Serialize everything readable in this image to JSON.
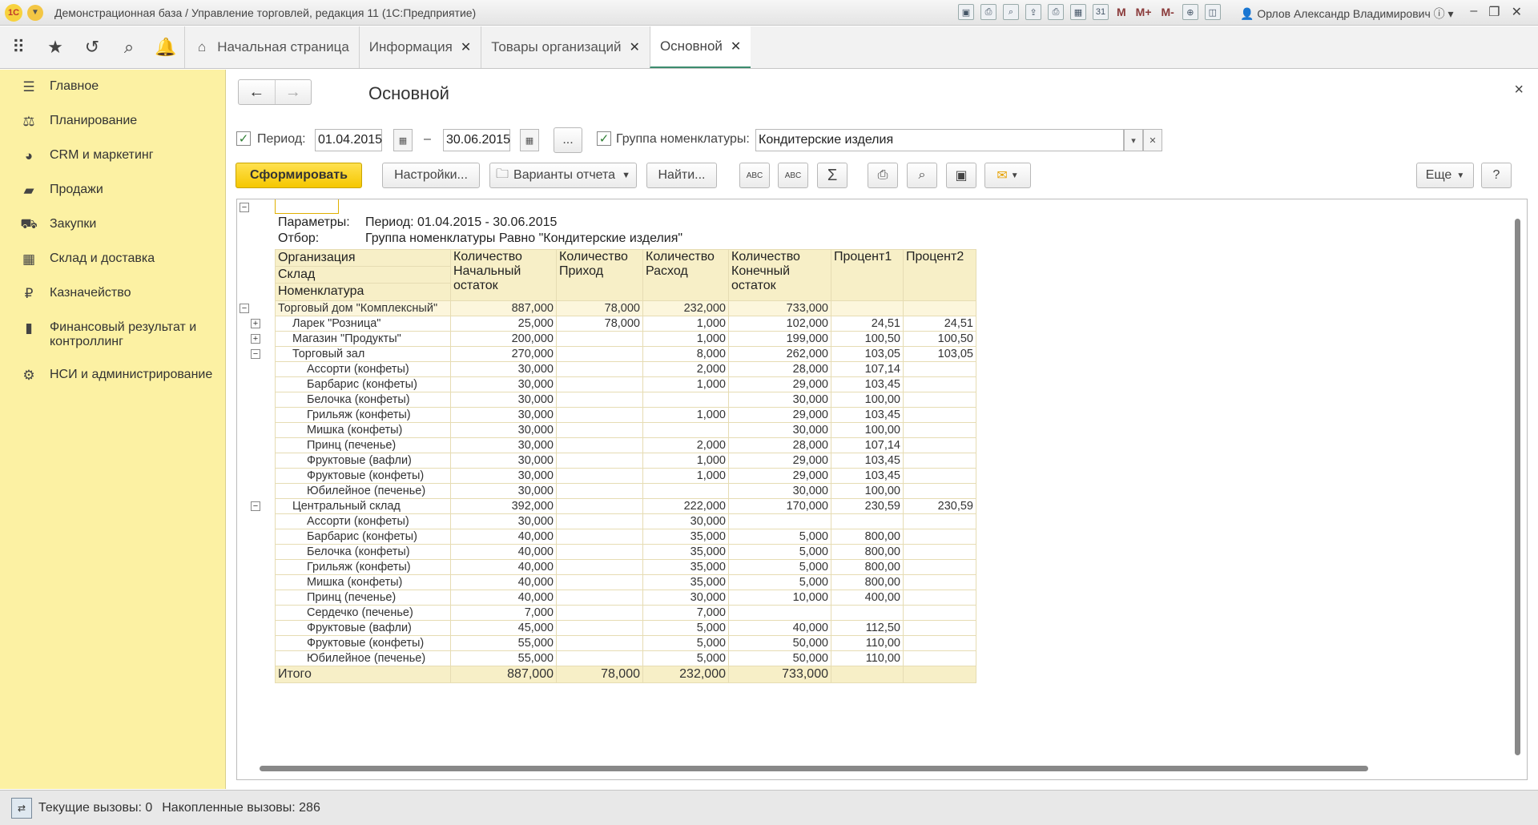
{
  "window": {
    "title": "Демонстрационная база / Управление торговлей, редакция 11  (1С:Предприятие)",
    "user": "Орлов Александр Владимирович",
    "logo": "1C",
    "m_buttons": [
      "M",
      "M+",
      "M-"
    ]
  },
  "tabs": [
    {
      "label": "Начальная страница"
    },
    {
      "label": "Информация"
    },
    {
      "label": "Товары организаций"
    },
    {
      "label": "Основной"
    }
  ],
  "sidebar": {
    "items": [
      {
        "label": "Главное",
        "icon": "menu-icon"
      },
      {
        "label": "Планирование",
        "icon": "planning-icon"
      },
      {
        "label": "CRM и маркетинг",
        "icon": "pie-icon"
      },
      {
        "label": "Продажи",
        "icon": "bag-icon"
      },
      {
        "label": "Закупки",
        "icon": "cart-icon"
      },
      {
        "label": "Склад и доставка",
        "icon": "warehouse-icon"
      },
      {
        "label": "Казначейство",
        "icon": "ruble-icon"
      },
      {
        "label": "Финансовый результат и контроллинг",
        "icon": "chart-icon"
      },
      {
        "label": "НСИ и администрирование",
        "icon": "gear-icon"
      }
    ]
  },
  "form": {
    "title": "Основной",
    "period_label": "Период:",
    "date_from": "01.04.2015",
    "dash": "–",
    "date_to": "30.06.2015",
    "ellipsis": "...",
    "group_label": "Группа номенклатуры:",
    "group_value": "Кондитерские изделия",
    "buttons": {
      "generate": "Сформировать",
      "settings": "Настройки...",
      "variants": "Варианты отчета",
      "find": "Найти...",
      "more": "Еще",
      "help": "?"
    }
  },
  "report": {
    "params_label": "Параметры:",
    "params_value": "Период: 01.04.2015 - 30.06.2015",
    "filter_label": "Отбор:",
    "filter_value": "Группа номенклатуры Равно \"Кондитерские изделия\"",
    "headers": {
      "org": "Организация",
      "wh": "Склад",
      "item": "Номенклатура",
      "c1": "Количество Начальный остаток",
      "c2": "Количество Приход",
      "c3": "Количество Расход",
      "c4": "Количество Конечный остаток",
      "c5": "Процент1",
      "c6": "Процент2"
    },
    "rows": [
      {
        "level": 0,
        "name": "Торговый дом \"Комплексный\"",
        "v": [
          "887,000",
          "78,000",
          "232,000",
          "733,000",
          "",
          ""
        ]
      },
      {
        "level": 1,
        "name": "Ларек \"Розница\"",
        "v": [
          "25,000",
          "78,000",
          "1,000",
          "102,000",
          "24,51",
          "24,51"
        ]
      },
      {
        "level": 1,
        "name": "Магазин \"Продукты\"",
        "v": [
          "200,000",
          "",
          "1,000",
          "199,000",
          "100,50",
          "100,50"
        ]
      },
      {
        "level": 1,
        "name": "Торговый зал",
        "v": [
          "270,000",
          "",
          "8,000",
          "262,000",
          "103,05",
          "103,05"
        ]
      },
      {
        "level": 2,
        "name": "Ассорти (конфеты)",
        "v": [
          "30,000",
          "",
          "2,000",
          "28,000",
          "107,14",
          ""
        ]
      },
      {
        "level": 2,
        "name": "Барбарис (конфеты)",
        "v": [
          "30,000",
          "",
          "1,000",
          "29,000",
          "103,45",
          ""
        ]
      },
      {
        "level": 2,
        "name": "Белочка (конфеты)",
        "v": [
          "30,000",
          "",
          "",
          "30,000",
          "100,00",
          ""
        ]
      },
      {
        "level": 2,
        "name": "Грильяж (конфеты)",
        "v": [
          "30,000",
          "",
          "1,000",
          "29,000",
          "103,45",
          ""
        ]
      },
      {
        "level": 2,
        "name": "Мишка (конфеты)",
        "v": [
          "30,000",
          "",
          "",
          "30,000",
          "100,00",
          ""
        ]
      },
      {
        "level": 2,
        "name": "Принц (печенье)",
        "v": [
          "30,000",
          "",
          "2,000",
          "28,000",
          "107,14",
          ""
        ]
      },
      {
        "level": 2,
        "name": "Фруктовые (вафли)",
        "v": [
          "30,000",
          "",
          "1,000",
          "29,000",
          "103,45",
          ""
        ]
      },
      {
        "level": 2,
        "name": "Фруктовые (конфеты)",
        "v": [
          "30,000",
          "",
          "1,000",
          "29,000",
          "103,45",
          ""
        ]
      },
      {
        "level": 2,
        "name": "Юбилейное (печенье)",
        "v": [
          "30,000",
          "",
          "",
          "30,000",
          "100,00",
          ""
        ]
      },
      {
        "level": 1,
        "name": "Центральный склад",
        "v": [
          "392,000",
          "",
          "222,000",
          "170,000",
          "230,59",
          "230,59"
        ]
      },
      {
        "level": 2,
        "name": "Ассорти (конфеты)",
        "v": [
          "30,000",
          "",
          "30,000",
          "",
          "",
          ""
        ]
      },
      {
        "level": 2,
        "name": "Барбарис (конфеты)",
        "v": [
          "40,000",
          "",
          "35,000",
          "5,000",
          "800,00",
          ""
        ]
      },
      {
        "level": 2,
        "name": "Белочка (конфеты)",
        "v": [
          "40,000",
          "",
          "35,000",
          "5,000",
          "800,00",
          ""
        ]
      },
      {
        "level": 2,
        "name": "Грильяж (конфеты)",
        "v": [
          "40,000",
          "",
          "35,000",
          "5,000",
          "800,00",
          ""
        ]
      },
      {
        "level": 2,
        "name": "Мишка (конфеты)",
        "v": [
          "40,000",
          "",
          "35,000",
          "5,000",
          "800,00",
          ""
        ]
      },
      {
        "level": 2,
        "name": "Принц (печенье)",
        "v": [
          "40,000",
          "",
          "30,000",
          "10,000",
          "400,00",
          ""
        ]
      },
      {
        "level": 2,
        "name": "Сердечко (печенье)",
        "v": [
          "7,000",
          "",
          "7,000",
          "",
          "",
          ""
        ]
      },
      {
        "level": 2,
        "name": "Фруктовые (вафли)",
        "v": [
          "45,000",
          "",
          "5,000",
          "40,000",
          "112,50",
          ""
        ]
      },
      {
        "level": 2,
        "name": "Фруктовые (конфеты)",
        "v": [
          "55,000",
          "",
          "5,000",
          "50,000",
          "110,00",
          ""
        ]
      },
      {
        "level": 2,
        "name": "Юбилейное (печенье)",
        "v": [
          "55,000",
          "",
          "5,000",
          "50,000",
          "110,00",
          ""
        ]
      }
    ],
    "total": {
      "name": "Итого",
      "v": [
        "887,000",
        "78,000",
        "232,000",
        "733,000",
        "",
        ""
      ]
    }
  },
  "status": {
    "current": "Текущие вызовы: 0",
    "accumulated": "Накопленные вызовы: 286"
  }
}
